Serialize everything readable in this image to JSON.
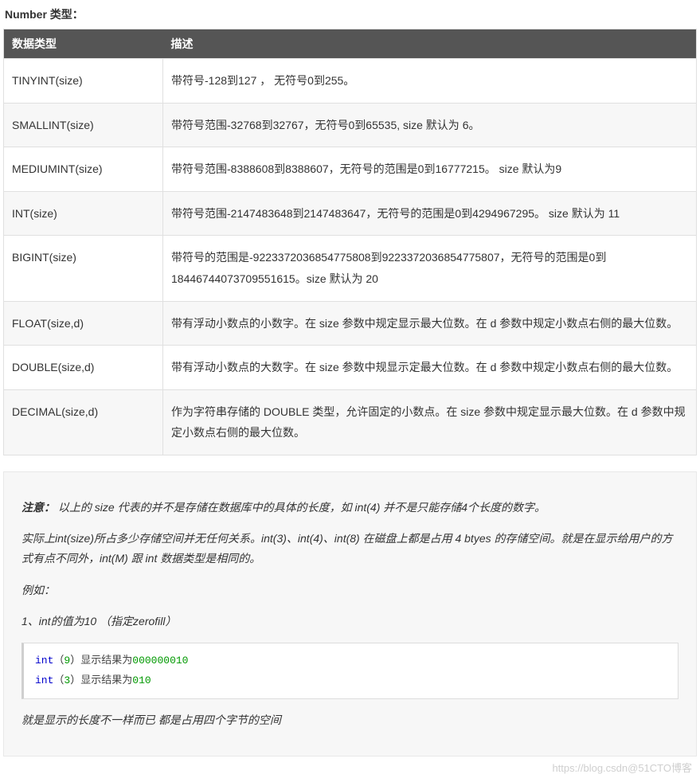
{
  "heading": "Number 类型：",
  "table": {
    "headers": {
      "col1": "数据类型",
      "col2": "描述"
    },
    "rows": [
      {
        "type": "TINYINT(size)",
        "desc": "带符号-128到127 ， 无符号0到255。"
      },
      {
        "type": "SMALLINT(size)",
        "desc": "带符号范围-32768到32767，无符号0到65535, size 默认为 6。"
      },
      {
        "type": "MEDIUMINT(size)",
        "desc": "带符号范围-8388608到8388607，无符号的范围是0到16777215。 size 默认为9"
      },
      {
        "type": "INT(size)",
        "desc": "带符号范围-2147483648到2147483647，无符号的范围是0到4294967295。 size 默认为 11"
      },
      {
        "type": "BIGINT(size)",
        "desc": "带符号的范围是-9223372036854775808到9223372036854775807，无符号的范围是0到18446744073709551615。size 默认为 20"
      },
      {
        "type": "FLOAT(size,d)",
        "desc": "带有浮动小数点的小数字。在 size 参数中规定显示最大位数。在 d 参数中规定小数点右侧的最大位数。"
      },
      {
        "type": "DOUBLE(size,d)",
        "desc": "带有浮动小数点的大数字。在 size 参数中规显示定最大位数。在 d 参数中规定小数点右侧的最大位数。"
      },
      {
        "type": "DECIMAL(size,d)",
        "desc": "作为字符串存储的 DOUBLE 类型，允许固定的小数点。在 size 参数中规定显示最大位数。在 d 参数中规定小数点右侧的最大位数。"
      }
    ]
  },
  "note": {
    "label": "注意：",
    "p1_rest": "以上的 size 代表的并不是存储在数据库中的具体的长度，如 int(4) 并不是只能存储4个长度的数字。",
    "p2": "实际上int(size)所占多少存储空间并无任何关系。int(3)、int(4)、int(8) 在磁盘上都是占用 4 btyes 的存储空间。就是在显示给用户的方式有点不同外，int(M) 跟 int 数据类型是相同的。",
    "p3": "例如：",
    "p4": "1、int的值为10  （指定zerofill）",
    "code": {
      "l1": {
        "kw": "int",
        "paren_open": "（",
        "num": "9",
        "paren_close": "）",
        "txt": "显示结果为",
        "res": "000000010"
      },
      "l2": {
        "kw": "int",
        "paren_open": "（",
        "num": "3",
        "paren_close": "）",
        "txt": "显示结果为",
        "res": "010"
      }
    },
    "p5": "就是显示的长度不一样而已 都是占用四个字节的空间"
  },
  "watermark": "https://blog.csdn@51CTO博客"
}
